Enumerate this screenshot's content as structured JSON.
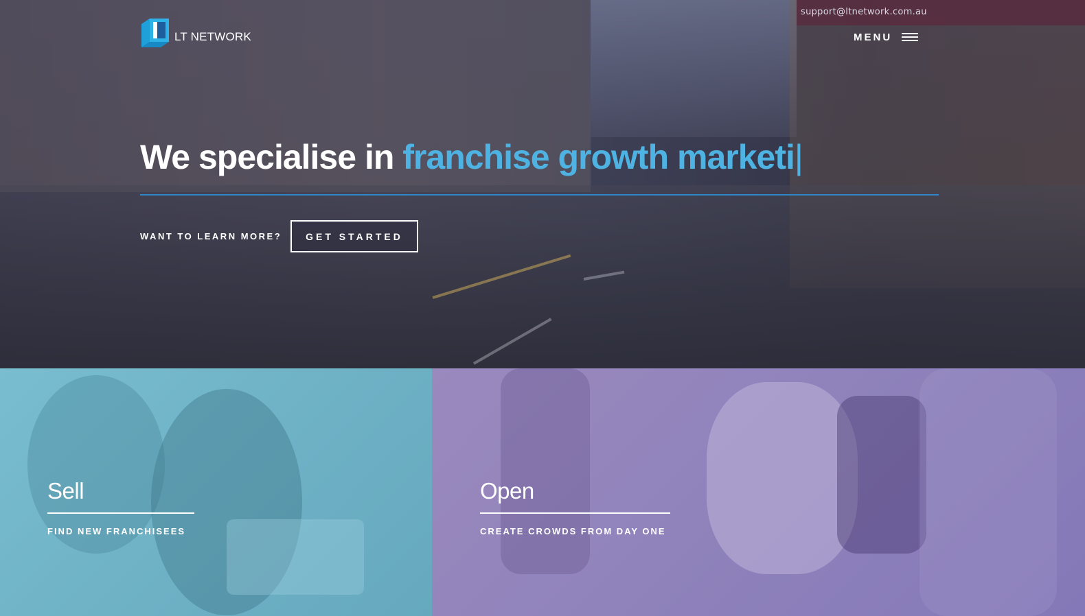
{
  "header": {
    "support_email": "support@ltnetwork.com.au",
    "logo_text": "LT NETWORK",
    "menu_label": "MENU"
  },
  "hero": {
    "headline_prefix": "We specialise in ",
    "headline_accent": "franchise growth marketi",
    "cursor": "|",
    "learn_more": "WANT TO LEARN MORE?",
    "cta_label": "GET STARTED"
  },
  "panels": [
    {
      "title": "Sell",
      "subtitle": "FIND NEW FRANCHISEES"
    },
    {
      "title": "Open",
      "subtitle": "CREATE CROWDS FROM DAY ONE"
    }
  ],
  "colors": {
    "accent": "#4eb3e3",
    "rule": "#2f86c8",
    "sell_panel": "#74b8cc",
    "open_panel": "#9085bb"
  }
}
